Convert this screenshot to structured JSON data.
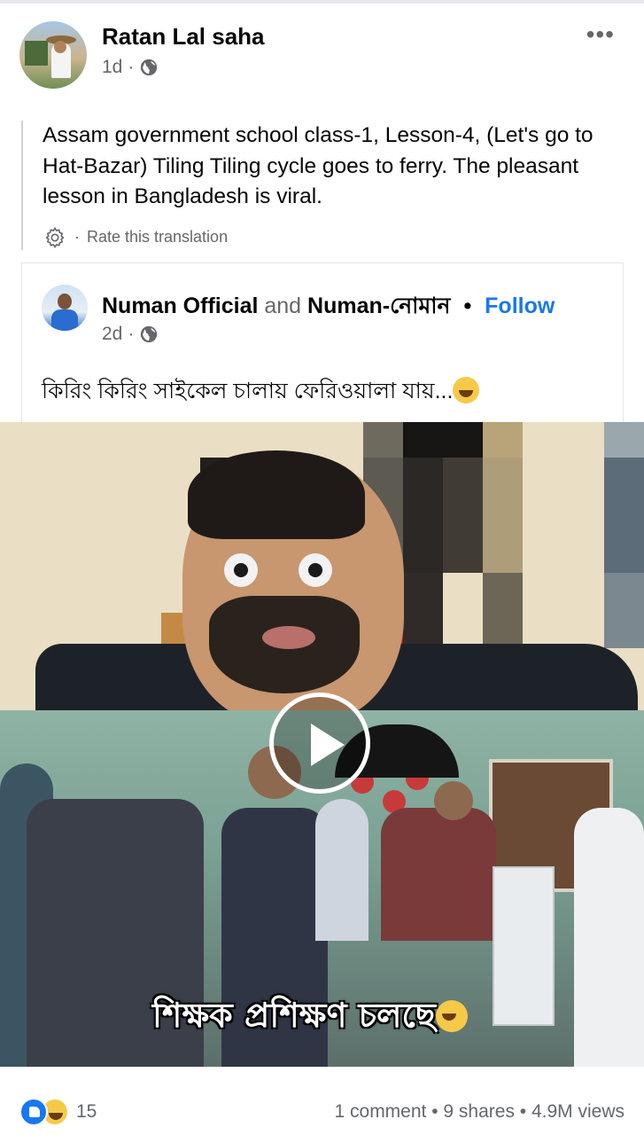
{
  "post": {
    "author": "Ratan Lal saha",
    "time": "1d",
    "meta_sep": "·",
    "more": "•••",
    "text": "Assam government school class-1, Lesson-4, (Let's go to Hat-Bazar) Tiling Tiling cycle goes to ferry. The pleasant lesson in Bangladesh is viral.",
    "rate_translation": "Rate this translation",
    "rate_sep": "·"
  },
  "shared": {
    "author1": "Numan Official",
    "and": "and",
    "author2": "Numan-নোমান",
    "dot": "•",
    "follow": "Follow",
    "time": "2d",
    "meta_sep": "·",
    "text": "কিরিং কিরিং সাইকেল চালায় ফেরিওয়ালা যায়..."
  },
  "video": {
    "caption": "শিক্ষক প্রশিক্ষণ চলছে"
  },
  "footer": {
    "reaction_count": "15",
    "stats": "1 comment • 9 shares • 4.9M views"
  }
}
